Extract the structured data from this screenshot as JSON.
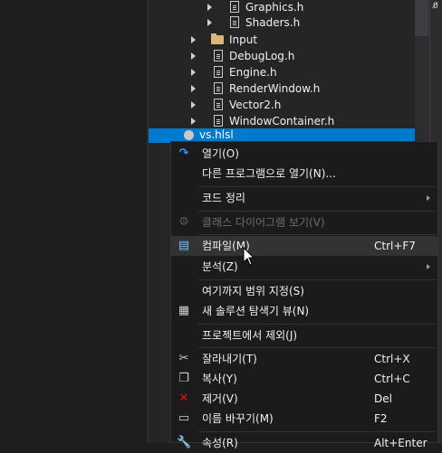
{
  "scrollbar": {
    "indicator_text": "0̸"
  },
  "tree": {
    "items": [
      {
        "label": "Graphics.h",
        "kind": "file"
      },
      {
        "label": "Shaders.h",
        "kind": "file"
      },
      {
        "label": "Input",
        "kind": "folder"
      },
      {
        "label": "DebugLog.h",
        "kind": "file"
      },
      {
        "label": "Engine.h",
        "kind": "file"
      },
      {
        "label": "RenderWindow.h",
        "kind": "file"
      },
      {
        "label": "Vector2.h",
        "kind": "file"
      },
      {
        "label": "WindowContainer.h",
        "kind": "file"
      }
    ],
    "selected": {
      "label": "vs.hlsl"
    }
  },
  "menu": {
    "items": [
      {
        "label": "열기(O)",
        "shortcut": "",
        "icon": "open-icon"
      },
      {
        "label": "다른 프로그램으로 열기(N)...",
        "shortcut": ""
      },
      {
        "label": "코드 정리",
        "shortcut": ""
      },
      {
        "label": "클래스 다이어그램 보기(V)",
        "shortcut": "",
        "icon": "class-diagram-icon"
      },
      {
        "label": "컴파일(M)",
        "shortcut": "Ctrl+F7",
        "icon": "compile-icon"
      },
      {
        "label": "분석(Z)",
        "shortcut": ""
      },
      {
        "label": "여기까지 범위 지정(S)",
        "shortcut": ""
      },
      {
        "label": "새 솔루션 탐색기 뷰(N)",
        "shortcut": "",
        "icon": "new-view-icon"
      },
      {
        "label": "프로젝트에서 제외(J)",
        "shortcut": ""
      },
      {
        "label": "잘라내기(T)",
        "shortcut": "Ctrl+X",
        "icon": "cut-icon"
      },
      {
        "label": "복사(Y)",
        "shortcut": "Ctrl+C",
        "icon": "copy-icon"
      },
      {
        "label": "제거(V)",
        "shortcut": "Del",
        "icon": "delete-icon"
      },
      {
        "label": "이름 바꾸기(M)",
        "shortcut": "F2",
        "icon": "rename-icon"
      },
      {
        "label": "속성(R)",
        "shortcut": "Alt+Enter",
        "icon": "properties-icon"
      }
    ]
  },
  "colors": {
    "selection": "#007acc",
    "menu_bg": "#1b1b1c",
    "delete_icon": "#e51400",
    "open_icon": "#3794ff"
  }
}
